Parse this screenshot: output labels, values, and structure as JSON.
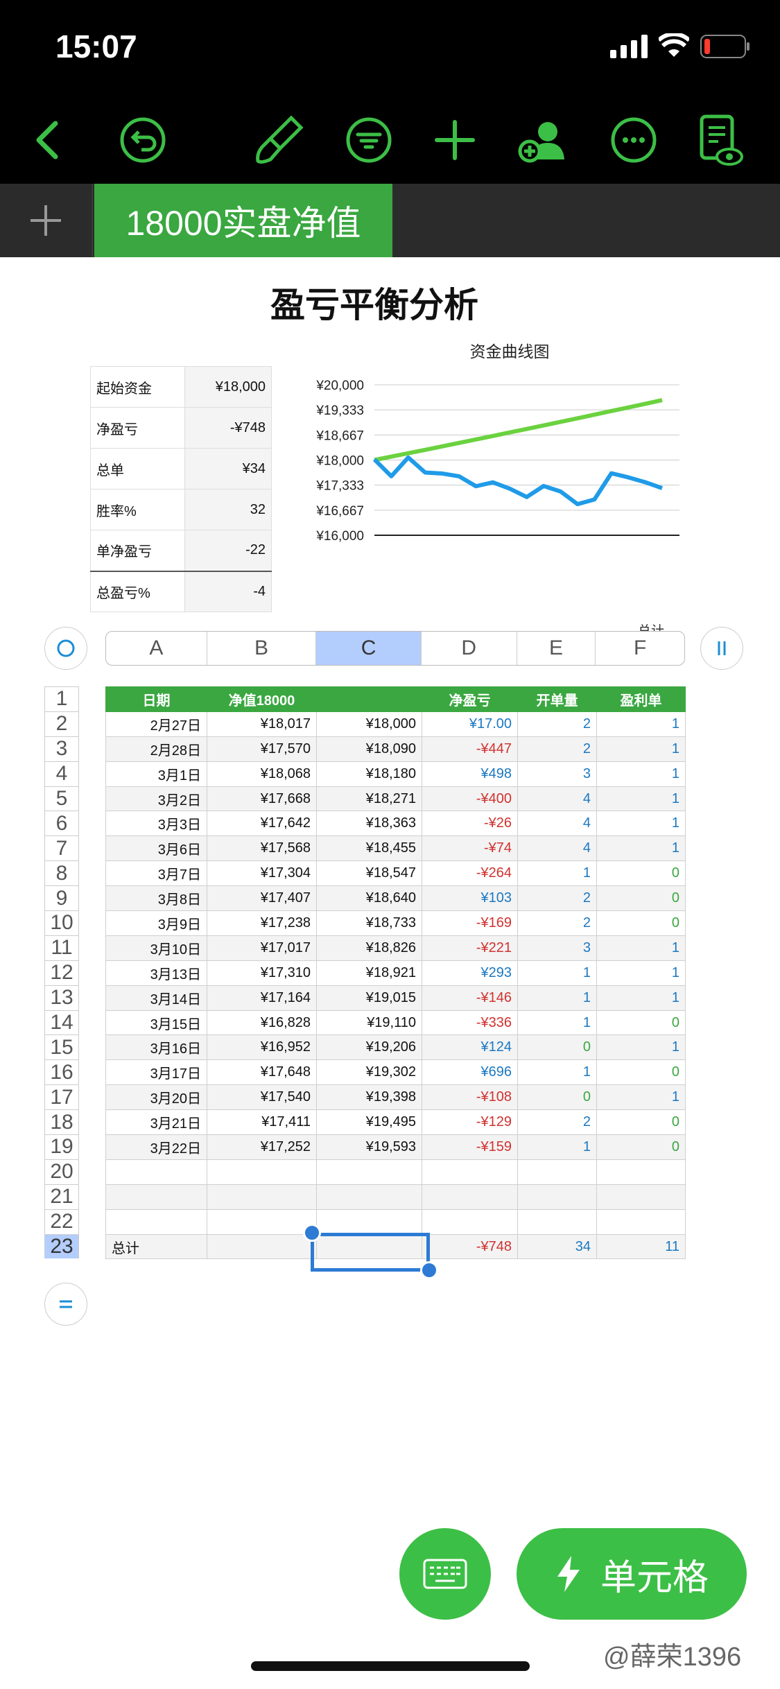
{
  "status_bar": {
    "time": "15:07"
  },
  "toolbar": {
    "icons": [
      "back-chevron-icon",
      "undo-icon",
      "paintbrush-icon",
      "filter-icon",
      "plus-icon",
      "collaborate-icon",
      "more-icon",
      "reader-view-icon"
    ]
  },
  "sheet_tabs": {
    "add_label": "+",
    "active_tab": "18000实盘净值"
  },
  "report_title": "盈亏平衡分析",
  "summary": [
    {
      "label": "起始资金",
      "value": "¥18,000"
    },
    {
      "label": "净盈亏",
      "value": "-¥748"
    },
    {
      "label": "总单",
      "value": "¥34"
    },
    {
      "label": "胜率%",
      "value": "32"
    },
    {
      "label": "单净盈亏",
      "value": "-22"
    },
    {
      "label": "总盈亏%",
      "value": "-4"
    }
  ],
  "chart_data": {
    "type": "line",
    "title": "资金曲线图",
    "ylim": [
      16000,
      20000
    ],
    "yticks": [
      "¥20,000",
      "¥19,333",
      "¥18,667",
      "¥18,000",
      "¥17,333",
      "¥16,667",
      "¥16,000"
    ],
    "tick_values": [
      20000,
      19333,
      18667,
      18000,
      17333,
      16667,
      16000
    ],
    "x_clipped_label": "总计",
    "categories": [
      "2月27日",
      "2月28日",
      "3月1日",
      "3月2日",
      "3月3日",
      "3月6日",
      "3月7日",
      "3月8日",
      "3月9日",
      "3月10日",
      "3月13日",
      "3月14日",
      "3月15日",
      "3月16日",
      "3月17日",
      "3月20日",
      "3月21日",
      "3月22日"
    ],
    "series": [
      {
        "values": [
          18017,
          17570,
          18068,
          17668,
          17642,
          17568,
          17304,
          17407,
          17238,
          17017,
          17310,
          17164,
          16828,
          16952,
          17648,
          17540,
          17411,
          17252
        ],
        "color": "#1f9be8"
      },
      {
        "values": [
          18000,
          18090,
          18180,
          18271,
          18363,
          18455,
          18547,
          18640,
          18733,
          18826,
          18921,
          19015,
          19110,
          19206,
          19302,
          19398,
          19495,
          19593
        ],
        "color": "#6bd23f"
      }
    ]
  },
  "column_headers": [
    "A",
    "B",
    "C",
    "D",
    "E",
    "F"
  ],
  "selected_column": "C",
  "row_numbers": [
    "1",
    "2",
    "3",
    "4",
    "5",
    "6",
    "7",
    "8",
    "9",
    "10",
    "11",
    "12",
    "13",
    "14",
    "15",
    "16",
    "17",
    "18",
    "19",
    "20",
    "21",
    "22",
    "23"
  ],
  "selected_row": "23",
  "table": {
    "headers": [
      "日期",
      "净值18000",
      "",
      "净盈亏",
      "开单量",
      "盈利单"
    ],
    "rows": [
      [
        "2月27日",
        "¥18,017",
        "¥18,000",
        "¥17.00",
        "2",
        "1"
      ],
      [
        "2月28日",
        "¥17,570",
        "¥18,090",
        "-¥447",
        "2",
        "1"
      ],
      [
        "3月1日",
        "¥18,068",
        "¥18,180",
        "¥498",
        "3",
        "1"
      ],
      [
        "3月2日",
        "¥17,668",
        "¥18,271",
        "-¥400",
        "4",
        "1"
      ],
      [
        "3月3日",
        "¥17,642",
        "¥18,363",
        "-¥26",
        "4",
        "1"
      ],
      [
        "3月6日",
        "¥17,568",
        "¥18,455",
        "-¥74",
        "4",
        "1"
      ],
      [
        "3月7日",
        "¥17,304",
        "¥18,547",
        "-¥264",
        "1",
        "0"
      ],
      [
        "3月8日",
        "¥17,407",
        "¥18,640",
        "¥103",
        "2",
        "0"
      ],
      [
        "3月9日",
        "¥17,238",
        "¥18,733",
        "-¥169",
        "2",
        "0"
      ],
      [
        "3月10日",
        "¥17,017",
        "¥18,826",
        "-¥221",
        "3",
        "1"
      ],
      [
        "3月13日",
        "¥17,310",
        "¥18,921",
        "¥293",
        "1",
        "1"
      ],
      [
        "3月14日",
        "¥17,164",
        "¥19,015",
        "-¥146",
        "1",
        "1"
      ],
      [
        "3月15日",
        "¥16,828",
        "¥19,110",
        "-¥336",
        "1",
        "0"
      ],
      [
        "3月16日",
        "¥16,952",
        "¥19,206",
        "¥124",
        "0",
        "1"
      ],
      [
        "3月17日",
        "¥17,648",
        "¥19,302",
        "¥696",
        "1",
        "0"
      ],
      [
        "3月20日",
        "¥17,540",
        "¥19,398",
        "-¥108",
        "0",
        "1"
      ],
      [
        "3月21日",
        "¥17,411",
        "¥19,495",
        "-¥129",
        "2",
        "0"
      ],
      [
        "3月22日",
        "¥17,252",
        "¥19,593",
        "-¥159",
        "1",
        "0"
      ]
    ],
    "total_row": [
      "总计",
      "",
      "",
      "-¥748",
      "34",
      "11"
    ]
  },
  "floating": {
    "keyboard_icon": "keyboard-icon",
    "cell_button_label": "单元格",
    "cell_button_icon": "lightning-icon"
  },
  "watermark": "@薛荣1396",
  "colors": {
    "green": "#3aa740",
    "blue": "#1a78c2",
    "red": "#d0322f",
    "toolbar_icon": "#3cbf46",
    "selection": "#2d7bd4"
  }
}
